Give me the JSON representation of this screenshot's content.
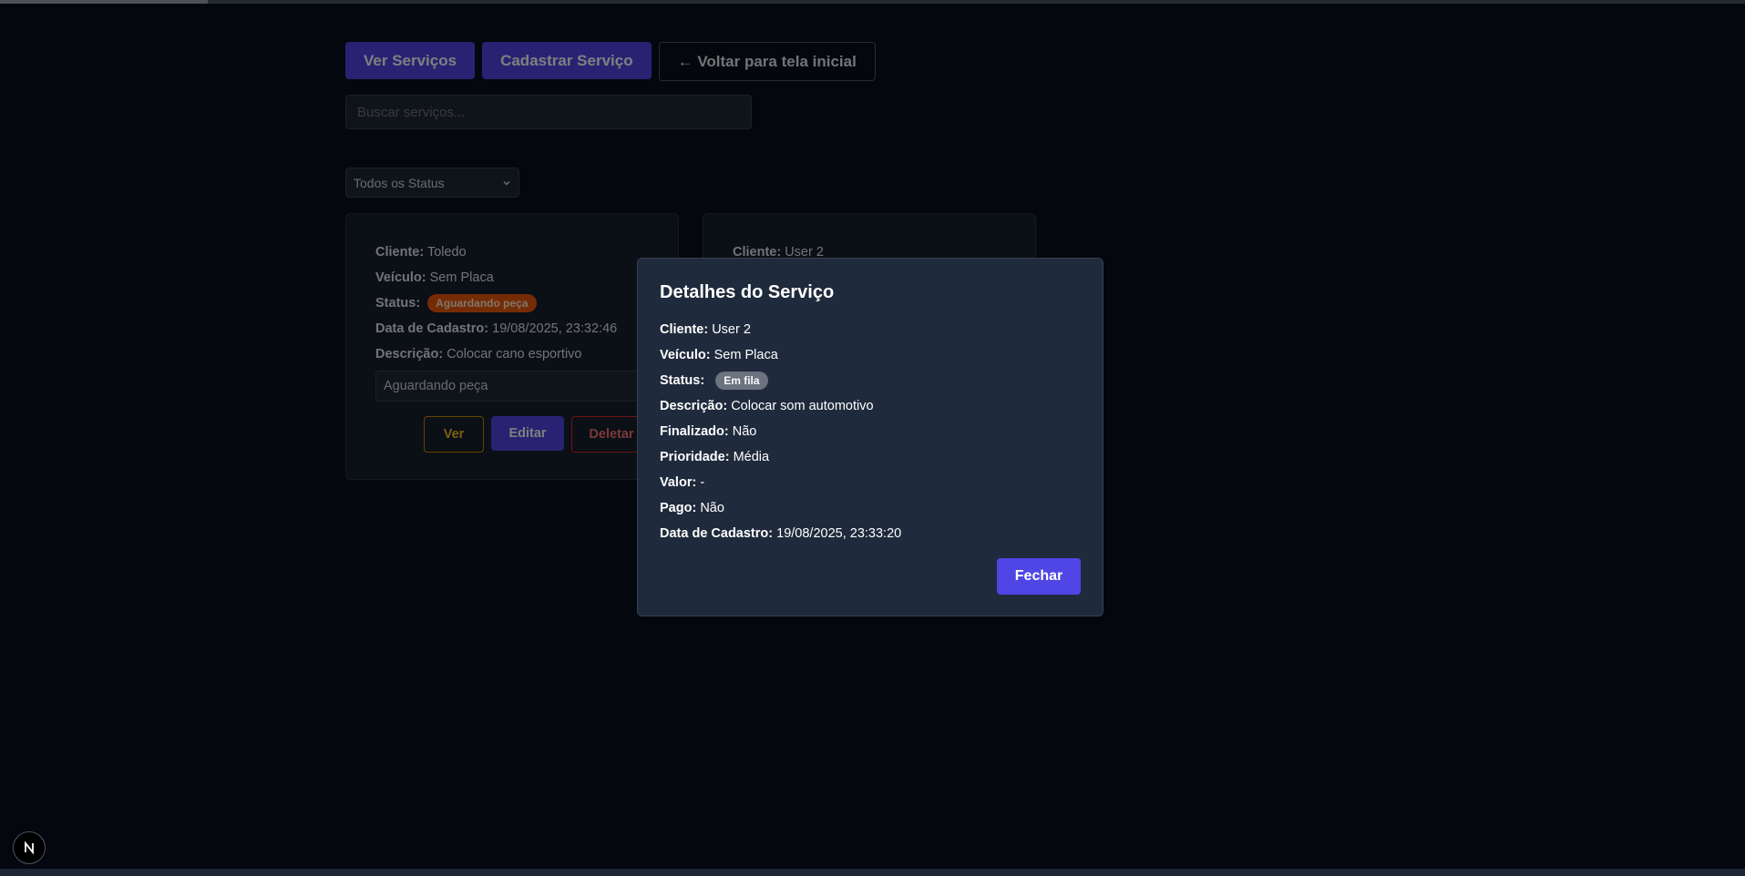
{
  "nav": {
    "view_services": "Ver Serviços",
    "register_service": "Cadastrar Serviço",
    "back_home": "← Voltar para tela inicial"
  },
  "search": {
    "placeholder": "Buscar serviços..."
  },
  "status_filter": {
    "selected": "Todos os Status"
  },
  "cards": [
    {
      "client_label": "Cliente:",
      "client": "Toledo",
      "vehicle_label": "Veículo:",
      "vehicle": "Sem Placa",
      "status_label": "Status:",
      "status": "Aguardando peça",
      "date_label": "Data de Cadastro:",
      "date": "19/08/2025, 23:32:46",
      "desc_label": "Descrição:",
      "desc": "Colocar cano esportivo",
      "status_select": "Aguardando peça",
      "ver": "Ver",
      "edit": "Editar",
      "delete": "Deletar"
    },
    {
      "client_label": "Cliente:",
      "client": "User 2"
    }
  ],
  "modal": {
    "title": "Detalhes do Serviço",
    "client_label": "Cliente:",
    "client": "User 2",
    "vehicle_label": "Veículo:",
    "vehicle": "Sem Placa",
    "status_label": "Status:",
    "status": "Em fila",
    "desc_label": "Descrição:",
    "desc": "Colocar som automotivo",
    "finished_label": "Finalizado:",
    "finished": "Não",
    "priority_label": "Prioridade:",
    "priority": "Média",
    "value_label": "Valor:",
    "value": "-",
    "paid_label": "Pago:",
    "paid": "Não",
    "date_label": "Data de Cadastro:",
    "date": "19/08/2025, 23:33:20",
    "close": "Fechar"
  },
  "colors": {
    "background": "#0a0f1c",
    "accent": "#4f46e5",
    "status_waiting": "#ea580c",
    "status_queue": "#6b7280"
  },
  "icons": {
    "next_badge": "nextjs-logo-icon",
    "select_arrow": "chevron-down-icon"
  }
}
